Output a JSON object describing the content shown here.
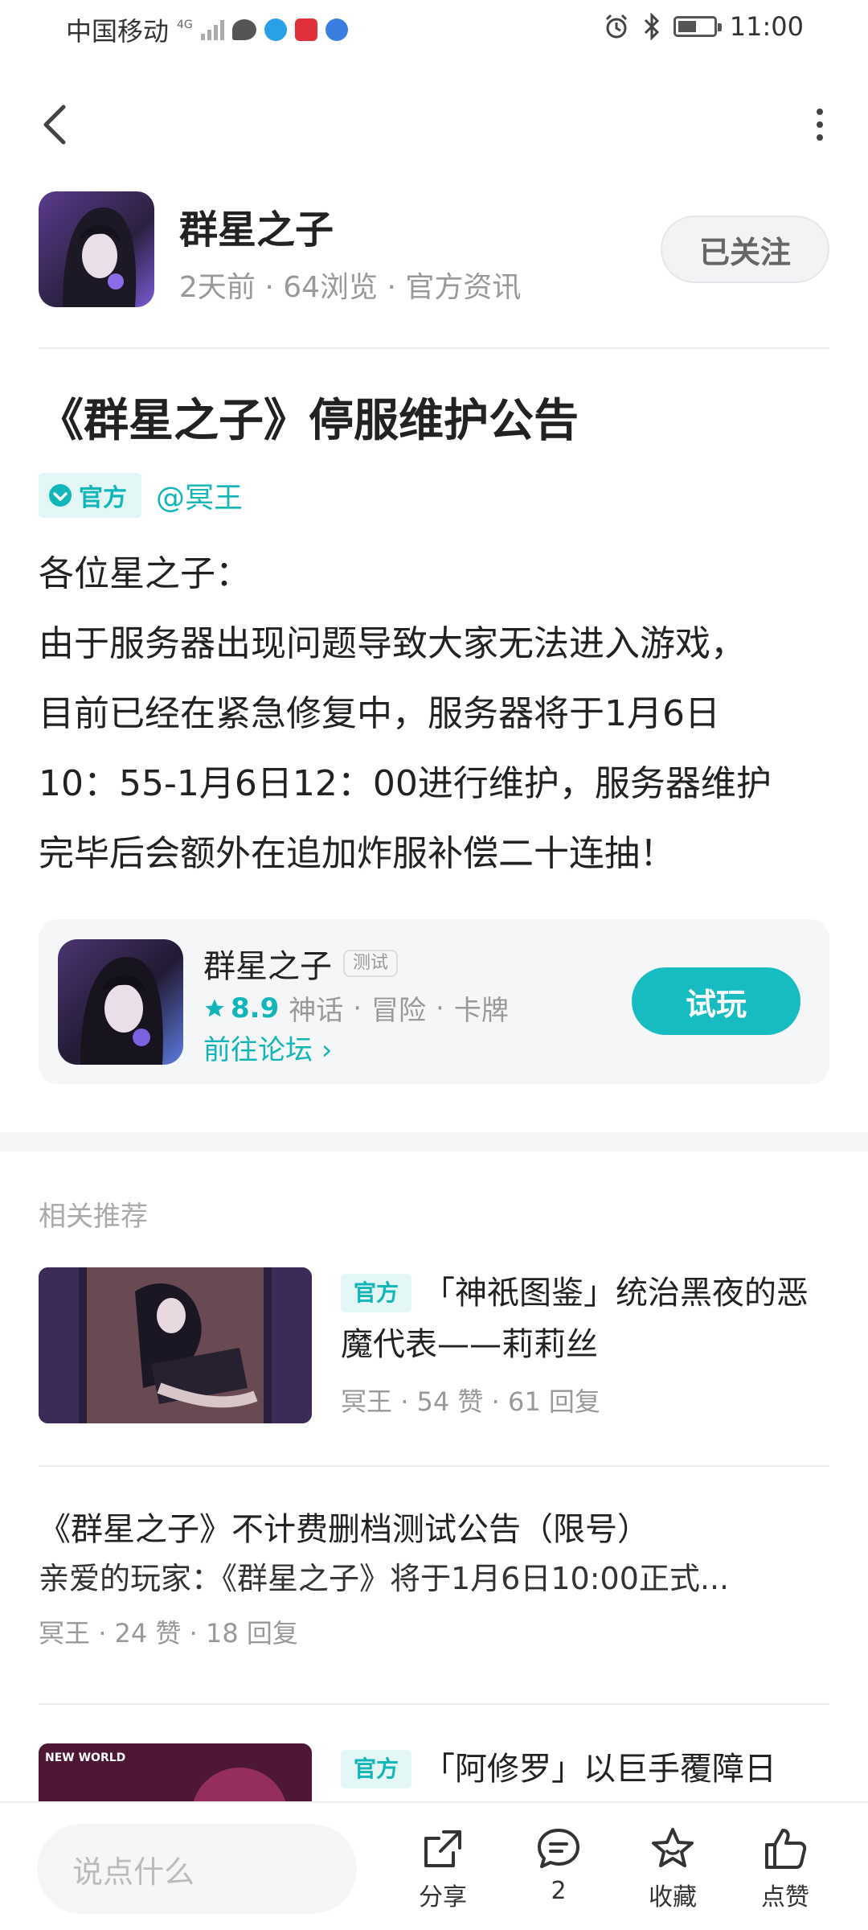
{
  "status_bar": {
    "carrier": "中国移动",
    "network": "4G",
    "time": "11:00"
  },
  "author": {
    "name": "群星之子",
    "time_ago": "2天前",
    "views": "64浏览",
    "category": "官方资讯",
    "follow_label": "已关注"
  },
  "article": {
    "title": "《群星之子》停服维护公告",
    "official_badge": "官方",
    "mention": "@冥王",
    "body_lines": [
      "各位星之子：",
      "由于服务器出现问题导致大家无法进入游戏，",
      "目前已经在紧急修复中，服务器将于1月6日",
      "10：55-1月6日12：00进行维护，服务器维护",
      "完毕后会额外在追加炸服补偿二十连抽！"
    ]
  },
  "game_card": {
    "name": "群星之子",
    "tag": "测试",
    "rating": "8.9",
    "genres": [
      "神话",
      "冒险",
      "卡牌"
    ],
    "forum_link": "前往论坛",
    "play_label": "试玩"
  },
  "related": {
    "section_title": "相关推荐",
    "items": [
      {
        "badge": "官方",
        "headline": "「神祇图鉴」统治黑夜的恶魔代表——莉莉丝",
        "author": "冥王",
        "likes": "54 赞",
        "replies": "61 回复"
      },
      {
        "title": "《群星之子》不计费删档测试公告（限号）",
        "excerpt": "亲爱的玩家：《群星之子》将于1月6日10:00正式...",
        "author": "冥王",
        "likes": "24 赞",
        "replies": "18 回复"
      },
      {
        "badge": "官方",
        "headline": "「阿修罗」以巨手覆障日",
        "thumb_text": "NEW WORLD"
      }
    ]
  },
  "bottom_bar": {
    "comment_placeholder": "说点什么",
    "share_label": "分享",
    "comment_count": "2",
    "favorite_label": "收藏",
    "like_label": "点赞"
  },
  "colors": {
    "accent": "#17bcc1",
    "accent_text": "#12b5b8",
    "badge_bg": "#e4f7f7"
  }
}
